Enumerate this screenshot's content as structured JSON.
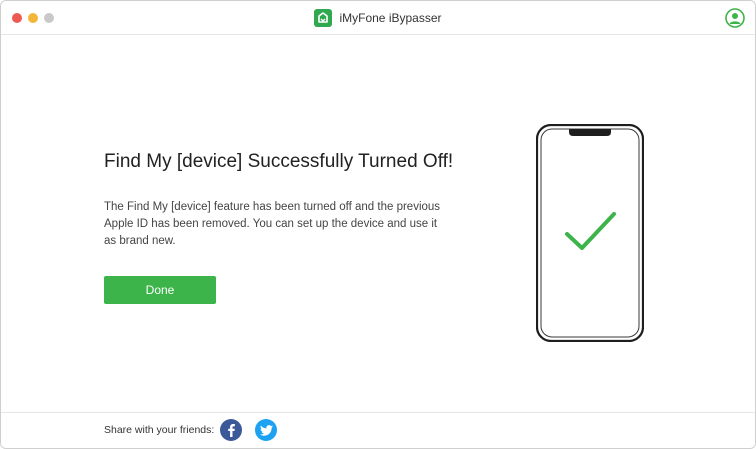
{
  "window": {
    "title": "iMyFone iBypasser"
  },
  "icons": {
    "logo": "imyfone-logo-icon",
    "account": "account-icon",
    "phone": "phone-illustration",
    "check": "check-icon",
    "facebook": "facebook-icon",
    "twitter": "twitter-icon"
  },
  "main": {
    "heading": "Find My [device] Successfully Turned Off!",
    "description": "The Find My [device] feature has been turned off and the previous Apple ID has been removed. You can set up the device and use it as brand new.",
    "done_label": "Done"
  },
  "footer": {
    "share_label": "Share with your friends:"
  },
  "colors": {
    "accent": "#3cb44a",
    "facebook": "#3b5998",
    "twitter": "#1da1f2"
  }
}
